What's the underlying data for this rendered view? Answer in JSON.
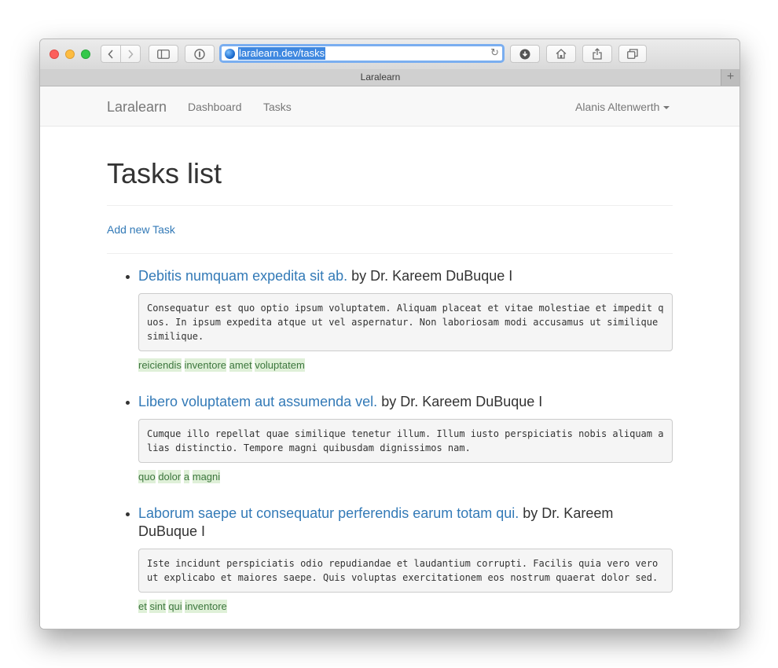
{
  "browser": {
    "address": "laralearn.dev/tasks",
    "tab_title": "Laralearn",
    "new_tab_label": "+"
  },
  "navbar": {
    "brand": "Laralearn",
    "links": [
      "Dashboard",
      "Tasks"
    ],
    "user": "Alanis Altenwerth"
  },
  "main": {
    "title": "Tasks list",
    "add_link": "Add new Task",
    "tasks": [
      {
        "title": "Debitis numquam expedita sit ab.",
        "author": " by Dr. Kareem DuBuque I",
        "description": "Consequatur est quo optio ipsum voluptatem. Aliquam placeat et vitae molestiae et impedit quos. In ipsum expedita atque ut vel aspernatur. Non laboriosam modi accusamus ut similique similique.",
        "tags": [
          "reiciendis",
          "inventore",
          "amet",
          "voluptatem"
        ]
      },
      {
        "title": "Libero voluptatem aut assumenda vel.",
        "author": " by Dr. Kareem DuBuque I",
        "description": "Cumque illo repellat quae similique tenetur illum. Illum iusto perspiciatis nobis aliquam alias distinctio. Tempore magni quibusdam dignissimos nam.",
        "tags": [
          "quo",
          "dolor",
          "a",
          "magni"
        ]
      },
      {
        "title": "Laborum saepe ut consequatur perferendis earum totam qui.",
        "author": " by Dr. Kareem DuBuque I",
        "description": "Iste incidunt perspiciatis odio repudiandae et laudantium corrupti. Facilis quia vero vero ut explicabo et maiores saepe. Quis voluptas exercitationem eos nostrum quaerat dolor sed.",
        "tags": [
          "et",
          "sint",
          "qui",
          "inventore"
        ]
      }
    ]
  }
}
